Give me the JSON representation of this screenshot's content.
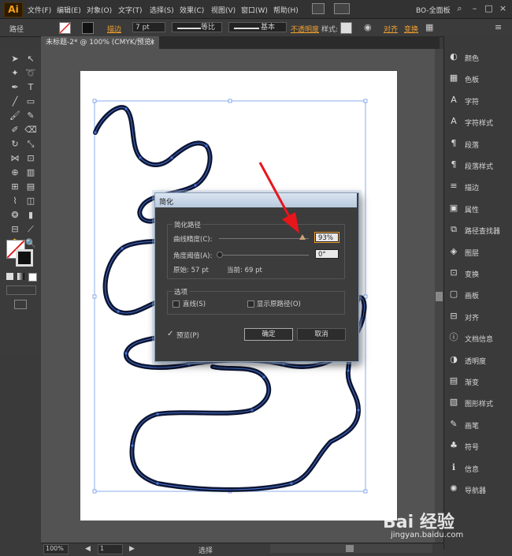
{
  "app": {
    "logo": "Ai",
    "workspace": "BO-全面板"
  },
  "menu": [
    "文件(F)",
    "编辑(E)",
    "对象(O)",
    "文字(T)",
    "选择(S)",
    "效果(C)",
    "视图(V)",
    "窗口(W)",
    "帮助(H)"
  ],
  "control": {
    "selection_label": "路径",
    "stroke_label": "描边",
    "stroke_weight": "7 pt",
    "profile_label": "等比",
    "brush_label": "基本",
    "opacity_label": "不透明度",
    "style_label": "样式:",
    "align_label": "对齐",
    "transform_label": "变换"
  },
  "document": {
    "tab": "未标题-2* @ 100% (CMYK/预览)",
    "close": "×"
  },
  "status": {
    "zoom": "100%",
    "artboard": "1",
    "tool": "选择"
  },
  "dialog": {
    "title": "简化",
    "group_path": "简化路径",
    "curve_precision_label": "曲线精度(C):",
    "curve_precision_value": "93%",
    "curve_precision_fraction": 0.93,
    "angle_label": "角度阈值(A):",
    "angle_value": "0°",
    "angle_fraction": 0.0,
    "original_label": "原始: 57 pt",
    "current_label": "当前: 69 pt",
    "group_options": "选项",
    "straight_lines_label": "直线(S)",
    "show_original_label": "显示原路径(O)",
    "preview_check": "✓",
    "preview_label": "预览(P)",
    "ok_label": "确定",
    "cancel_label": "取消"
  },
  "panels": [
    {
      "icon": "color-icon",
      "label": "颜色"
    },
    {
      "icon": "swatches-icon",
      "label": "色板"
    },
    {
      "icon": "character-icon",
      "label": "字符"
    },
    {
      "icon": "character-styles-icon",
      "label": "字符样式"
    },
    {
      "icon": "paragraph-icon",
      "label": "段落"
    },
    {
      "icon": "paragraph-styles-icon",
      "label": "段落样式"
    },
    {
      "icon": "stroke-icon",
      "label": "描边"
    },
    {
      "icon": "attributes-icon",
      "label": "属性"
    },
    {
      "icon": "pathfinder-icon",
      "label": "路径查找器"
    },
    {
      "icon": "layers-icon",
      "label": "图层"
    },
    {
      "icon": "transform-icon",
      "label": "变换"
    },
    {
      "icon": "artboards-icon",
      "label": "画板"
    },
    {
      "icon": "align-icon",
      "label": "对齐"
    },
    {
      "icon": "document-info-icon",
      "label": "文档信息"
    },
    {
      "icon": "transparency-icon",
      "label": "透明度"
    },
    {
      "icon": "gradient-icon",
      "label": "渐变"
    },
    {
      "icon": "graphic-styles-icon",
      "label": "图形样式"
    },
    {
      "icon": "brushes-icon",
      "label": "画笔"
    },
    {
      "icon": "symbols-icon",
      "label": "符号"
    },
    {
      "icon": "info-icon",
      "label": "信息"
    },
    {
      "icon": "navigator-icon",
      "label": "导航器"
    }
  ],
  "watermark": {
    "brand": "Bai 经验",
    "url": "jingyan.baidu.com"
  },
  "colors": {
    "accent": "#f0a030",
    "path": "#0d1533",
    "selection": "#4a78d8"
  }
}
